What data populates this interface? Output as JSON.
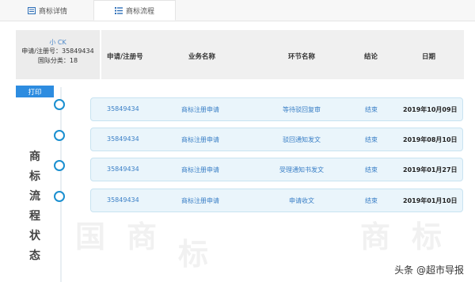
{
  "tabs": [
    {
      "label": "商标详情"
    },
    {
      "label": "商标流程"
    }
  ],
  "header": {
    "name": "小 CK",
    "reg_label": "申请/注册号：35849434",
    "class_label": "国际分类：18",
    "columns": [
      "申请/注册号",
      "业务名称",
      "环节名称",
      "结论",
      "日期"
    ]
  },
  "print_label": "打印",
  "side_label": [
    "商",
    "标",
    "流",
    "程",
    "状",
    "态"
  ],
  "rows": [
    {
      "reg_no": "35849434",
      "business": "商标注册申请",
      "step": "等待驳回复审",
      "result": "结束",
      "date": "2019年10月09日"
    },
    {
      "reg_no": "35849434",
      "business": "商标注册申请",
      "step": "驳回通知发文",
      "result": "结束",
      "date": "2019年08月10日"
    },
    {
      "reg_no": "35849434",
      "business": "商标注册申请",
      "step": "受理通知书发文",
      "result": "结束",
      "date": "2019年01月27日"
    },
    {
      "reg_no": "35849434",
      "business": "商标注册申请",
      "step": "申请收文",
      "result": "结束",
      "date": "2019年01月10日"
    }
  ],
  "credit": "头条 @超市导报",
  "colors": {
    "accent": "#2d8ce0",
    "dot": "#1a8fd0",
    "card": "#eaf5fb"
  }
}
